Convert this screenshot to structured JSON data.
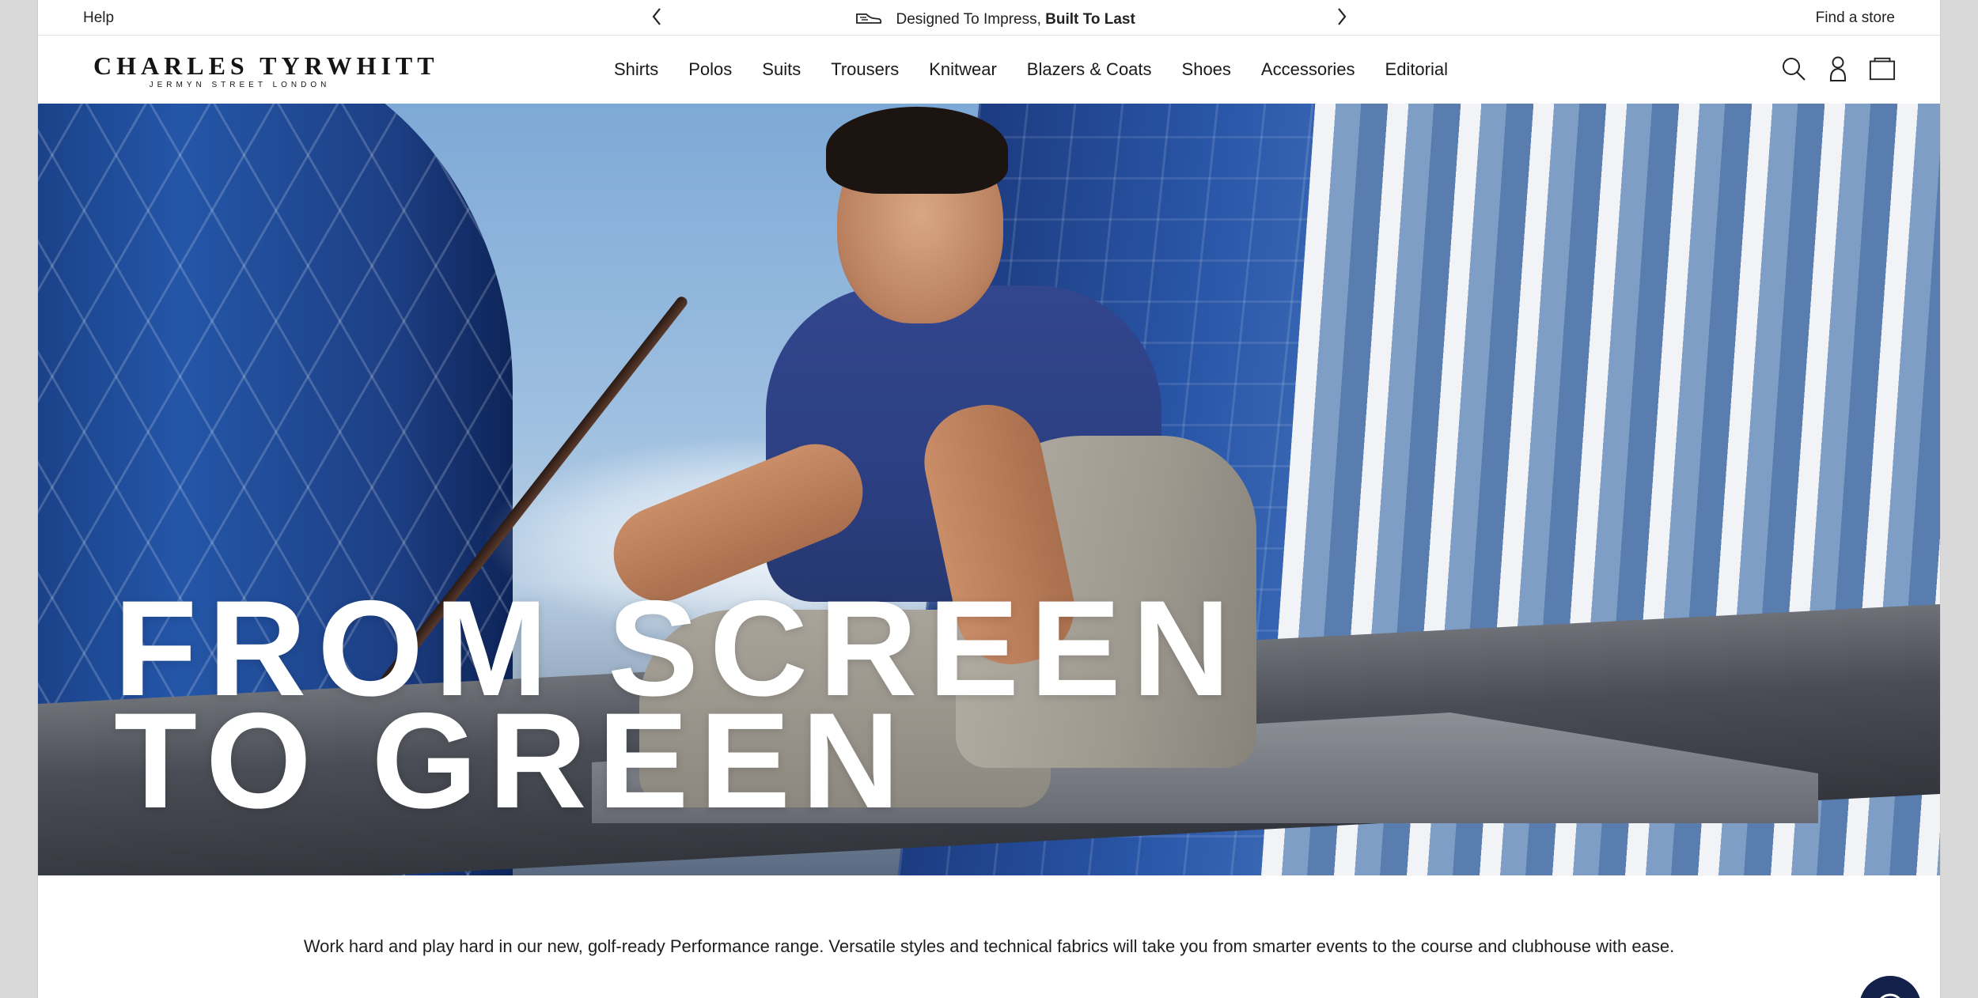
{
  "utility_bar": {
    "help_label": "Help",
    "find_store_label": "Find a store",
    "promo": {
      "prefix": "Designed To Impress,",
      "emphasis": "Built To Last",
      "icon": "shoe-icon",
      "prev_icon": "chevron-left-icon",
      "next_icon": "chevron-right-icon"
    }
  },
  "header": {
    "logo": {
      "brand": "CHARLES TYRWHITT",
      "subtitle": "JERMYN STREET LONDON"
    },
    "nav": [
      "Shirts",
      "Polos",
      "Suits",
      "Trousers",
      "Knitwear",
      "Blazers & Coats",
      "Shoes",
      "Accessories",
      "Editorial"
    ],
    "tools": [
      "search-icon",
      "account-icon",
      "bag-icon"
    ]
  },
  "hero": {
    "headline_line1": "FROM SCREEN",
    "headline_line2": "TO GREEN"
  },
  "description": "Work hard and play hard in our new, golf-ready Performance range. Versatile styles and technical fabrics will take you from smarter events to the course and clubhouse with ease.",
  "chat": {
    "icon": "chat-icon"
  },
  "colors": {
    "brand_navy": "#12204a",
    "text": "#1a1a1a",
    "background": "#ffffff"
  }
}
